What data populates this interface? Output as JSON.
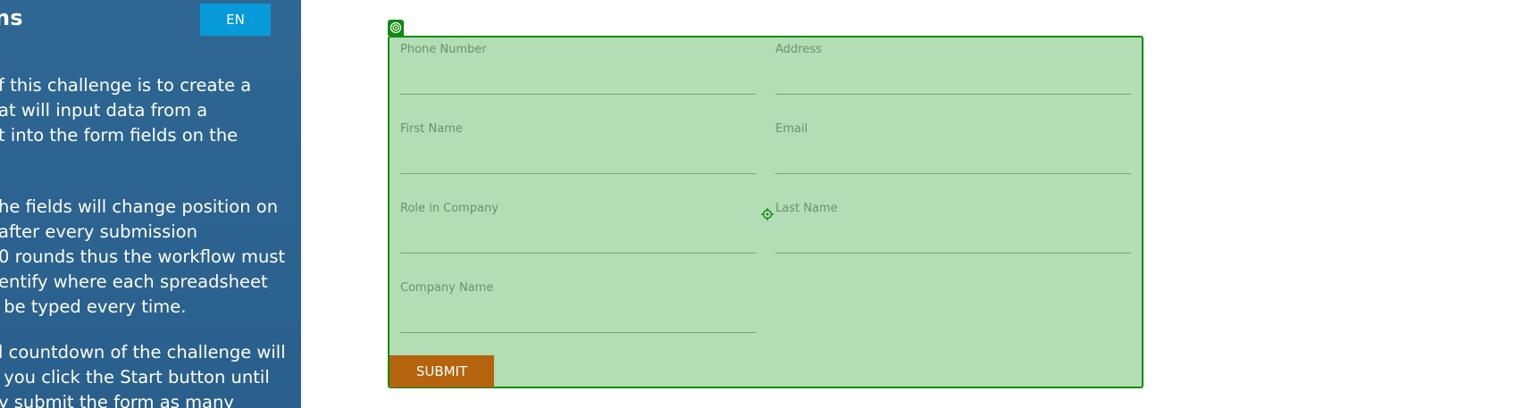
{
  "panel": {
    "title": "ns",
    "language": "EN",
    "paragraphs": [
      "f this challenge is to create a\nat will input data from a\nt into the form fields on the",
      "he fields will change position on\nafter every submission\n0 rounds thus the workflow must\nentify where each spreadsheet\n be typed every time.",
      "l countdown of the challenge will\n you click the Start button until\ny submit the form as many"
    ]
  },
  "form": {
    "fields": {
      "phone": "Phone Number",
      "address": "Address",
      "first_name": "First Name",
      "email": "Email",
      "role": "Role in Company",
      "last_name": "Last Name",
      "company": "Company Name"
    },
    "submit_label": "SUBMIT"
  },
  "colors": {
    "panel_bg": "#2c6391",
    "lang_button": "#069ad9",
    "form_bg": "#b3ddb4",
    "form_border": "#0f8a0f",
    "submit_bg": "#b5630d"
  },
  "icons": {
    "corner": "target-icon",
    "field_marker": "crosshair-icon"
  }
}
